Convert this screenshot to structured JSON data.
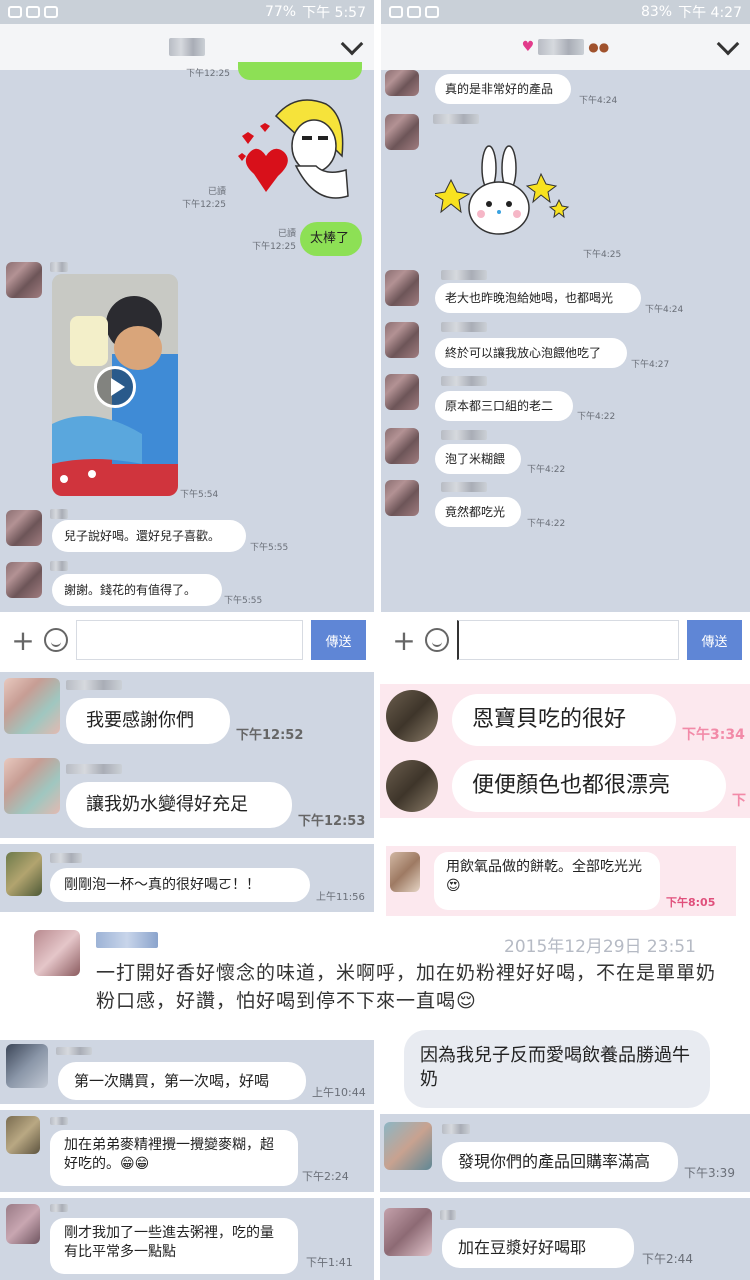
{
  "colors": {
    "panel": "#cfd6e2",
    "green_bubble": "#8de055",
    "send_button": "#5f86d6",
    "pink_panel": "#fce8ee"
  },
  "left_panel": {
    "status": {
      "battery": "77%",
      "time": "下午 5:57"
    },
    "messages": {
      "top_time": "下午12:25",
      "sticker_read": "已讀",
      "sticker_time": "下午12:25",
      "green_read": "已讀",
      "green_time": "下午12:25",
      "green_text": "太棒了",
      "video_time": "下午5:54",
      "msg1_text": "兒子說好喝。還好兒子喜歡。",
      "msg1_time": "下午5:55",
      "msg2_text": "謝謝。錢花的有值得了。",
      "msg2_time": "下午5:55"
    },
    "send_label": "傳送"
  },
  "right_panel": {
    "status": {
      "battery": "83%",
      "time": "下午 4:27"
    },
    "messages": [
      {
        "text": "真的是非常好的產品",
        "time": "下午4:24"
      },
      {
        "text": "老大也昨晚泡給她喝，也都喝光",
        "time": "下午4:24"
      },
      {
        "text": "終於可以讓我放心泡餵他吃了",
        "time": "下午4:27"
      },
      {
        "text": "原本都三口組的老二",
        "time": "下午4:22"
      },
      {
        "text": "泡了米糊餵",
        "time": "下午4:22"
      },
      {
        "text": "竟然都吃光",
        "time": "下午4:22"
      }
    ],
    "sticker_time": "下午4:25",
    "send_label": "傳送"
  },
  "collage": {
    "c1": {
      "text": "我要感謝你們",
      "time": "下午12:52"
    },
    "c2": {
      "text": "讓我奶水變得好充足",
      "time": "下午12:53"
    },
    "c3": {
      "text": "恩寶貝吃的很好",
      "time": "下午3:34"
    },
    "c4": {
      "text": "便便顏色也都很漂亮",
      "time": "下"
    },
    "c5": {
      "text": "剛剛泡一杯～真的很好喝ㄛ！！",
      "time": "上午11:56"
    },
    "c6": {
      "text": "用飲氧品做的餅乾。全部吃光光😍",
      "time": "下午8:05"
    },
    "c7": {
      "date": "2015年12月29日 23:51",
      "text": "一打開好香好懷念的味道，米啊呼，加在奶粉裡好好喝，不在是單單奶粉口感，好讚，怕好喝到停不下來一直喝😌"
    },
    "c8": {
      "text": "第一次購買，第一次喝，好喝",
      "time": "上午10:44"
    },
    "c9": {
      "text": "因為我兒子反而愛喝飲養品勝過牛奶"
    },
    "c10": {
      "text": "加在弟弟麥精裡攪一攪變麥糊，超好吃的。😁😁",
      "time": "下午2:24"
    },
    "c11": {
      "text": "發現你們的產品回購率滿高",
      "time": "下午3:39"
    },
    "c12": {
      "text": "剛才我加了一些進去粥裡，吃的量有比平常多一點點",
      "time": "下午1:41"
    },
    "c13": {
      "text": "加在豆漿好好喝耶",
      "time": "下午2:44"
    }
  }
}
